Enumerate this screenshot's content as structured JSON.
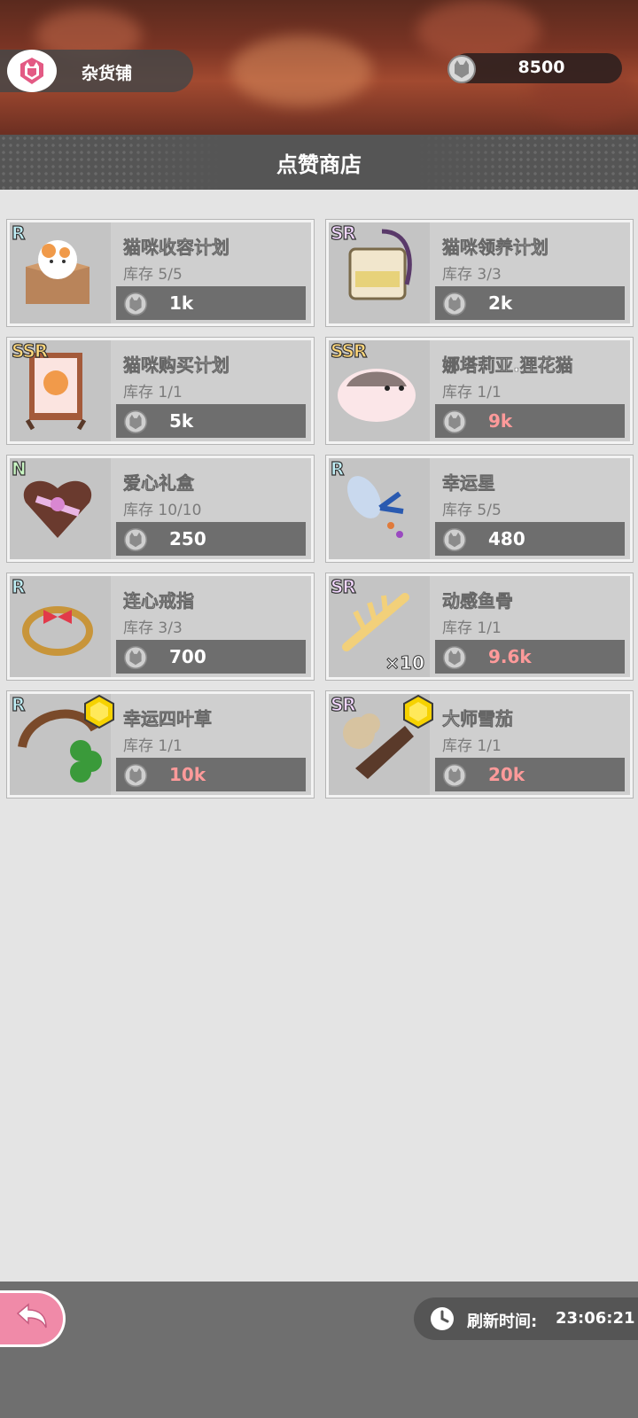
{
  "header": {
    "shop_name": "杂货铺",
    "currency_value": "8500",
    "page_title": "点赞商店"
  },
  "items": [
    {
      "rarity": "R",
      "name": "猫咪收容计划",
      "stock": "库存  5/5",
      "price": "1k",
      "price_color": "white"
    },
    {
      "rarity": "SR",
      "name": "猫咪领养计划",
      "stock": "库存  3/3",
      "price": "2k",
      "price_color": "white"
    },
    {
      "rarity": "SSR",
      "name": "猫咪购买计划",
      "stock": "库存  1/1",
      "price": "5k",
      "price_color": "white"
    },
    {
      "rarity": "SSR",
      "name": "娜塔莉亚.狸花猫",
      "stock": "库存  1/1",
      "price": "9k",
      "price_color": "red"
    },
    {
      "rarity": "N",
      "name": "爱心礼盒",
      "stock": "库存  10/10",
      "price": "250",
      "price_color": "white"
    },
    {
      "rarity": "R",
      "name": "幸运星",
      "stock": "库存  5/5",
      "price": "480",
      "price_color": "white"
    },
    {
      "rarity": "R",
      "name": "连心戒指",
      "stock": "库存  3/3",
      "price": "700",
      "price_color": "white"
    },
    {
      "rarity": "SR",
      "name": "动感鱼骨",
      "stock": "库存  1/1",
      "price": "9.6k",
      "price_color": "red",
      "quantity": "×10"
    },
    {
      "rarity": "R",
      "name": "幸运四叶草",
      "stock": "库存  1/1",
      "price": "10k",
      "price_color": "red"
    },
    {
      "rarity": "SR",
      "name": "大师雪茄",
      "stock": "库存  1/1",
      "price": "20k",
      "price_color": "red"
    }
  ],
  "footer": {
    "refresh_label": "刷新时间:",
    "refresh_time": "23:06:21"
  },
  "icons": {
    "shop": "cat-shield-icon",
    "coin": "cat-coin-icon",
    "back": "back-arrow-icon",
    "clock": "clock-icon",
    "gem": "yellow-gem-icon"
  },
  "colors": {
    "back_button": "#f08aa8",
    "price_red": "#ff9a9a"
  }
}
